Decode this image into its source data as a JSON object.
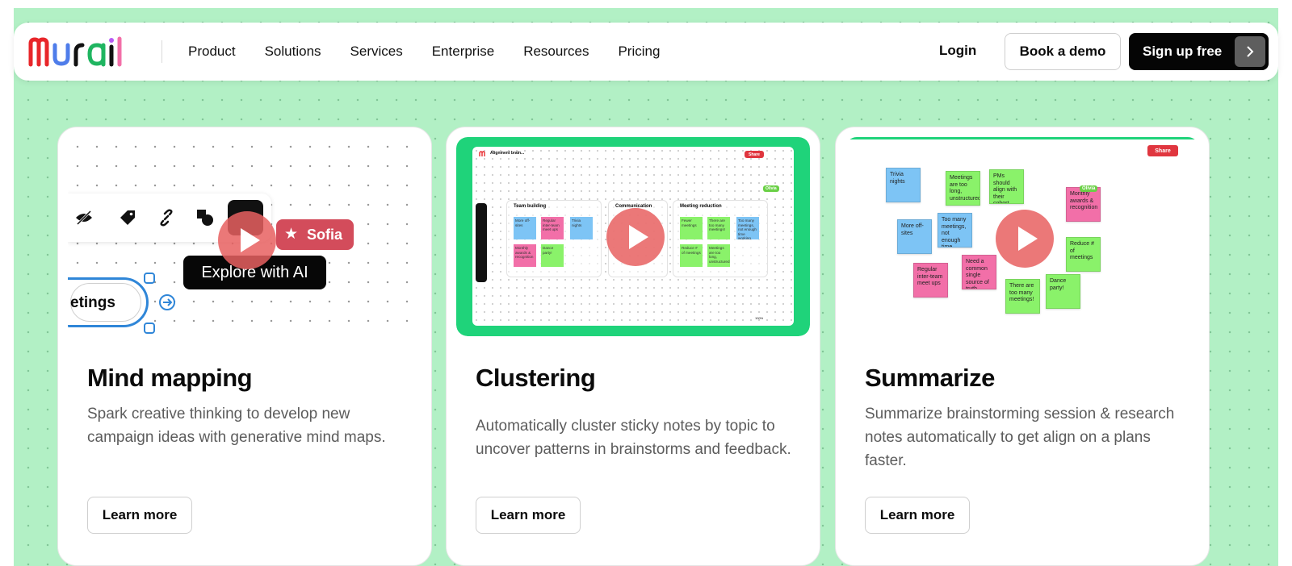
{
  "nav": {
    "logo_text": "mural",
    "links": [
      "Product",
      "Solutions",
      "Services",
      "Enterprise",
      "Resources",
      "Pricing"
    ],
    "login": "Login",
    "demo": "Book a demo",
    "signup": "Sign up free"
  },
  "colors": {
    "background": "#b2f0c5",
    "accent_green": "#1fd37a",
    "play_button": "#e86060",
    "brand_black": "#050505"
  },
  "cards": [
    {
      "title": "Mind mapping",
      "description": "Spark creative thinking to develop new campaign ideas with generative mind maps.",
      "cta": "Learn more",
      "media": {
        "collaborator": "Sofia",
        "tooltip": "Explore with AI",
        "node_label": "etings"
      }
    },
    {
      "title": "Clustering",
      "description": "Automatically cluster sticky notes by topic to uncover patterns in brainstorms and feedback.",
      "cta": "Learn more",
      "media": {
        "board_title": "Alignment brain...",
        "share": "Share",
        "collaborator": "Olivia",
        "zoom": "100%",
        "groups": [
          {
            "title": "Team building",
            "stickies": [
              "More off-sites",
              "Regular inter-team meet ups",
              "Trivia nights",
              "Monthly awards & recognition",
              "Dance party!"
            ]
          },
          {
            "title": "Communication",
            "stickies": []
          },
          {
            "title": "Meeting reduction",
            "stickies": [
              "Fewer meetings",
              "There are too many meetings!",
              "Too many meetings, not enough time working",
              "Reduce # of meetings",
              "Meetings are too long, unstructured"
            ]
          }
        ]
      }
    },
    {
      "title": "Summarize",
      "description": "Summarize brainstorming session & research notes automatically to get align on a plans faster.",
      "cta": "Learn more",
      "media": {
        "share": "Share",
        "collaborator": "Olivia",
        "stickies": [
          "Trivia nights",
          "Meetings are too long, unstructured",
          "PMs should align with their cohort",
          "Monthly awards & recognition",
          "More off-sites",
          "Too many meetings, not enough time working",
          "Reduce # of meetings",
          "Regular inter-team meet ups",
          "Need a common single source of truth",
          "There are too many meetings!",
          "Dance party!"
        ]
      }
    }
  ]
}
